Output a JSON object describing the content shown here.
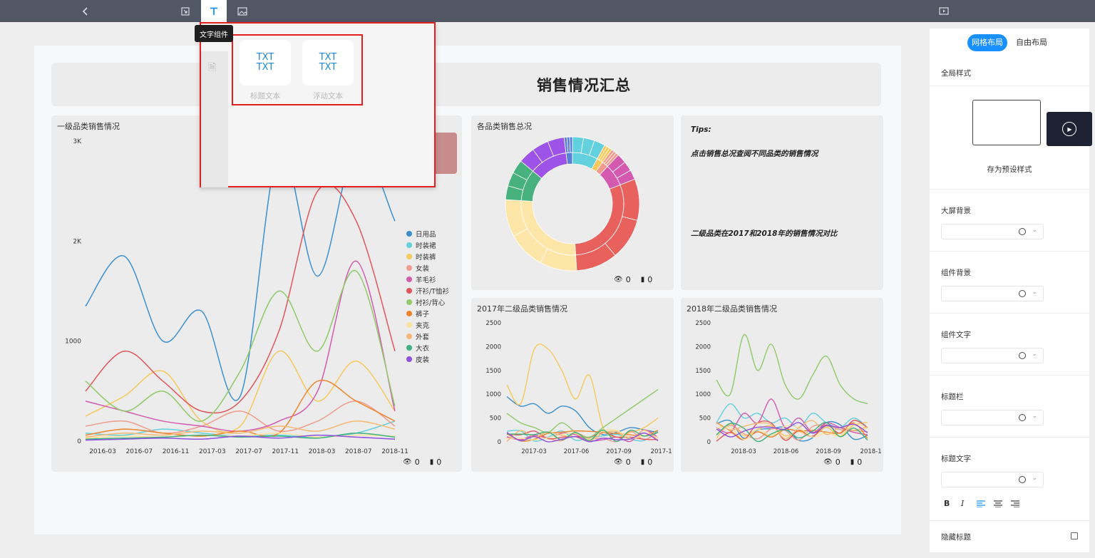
{
  "toolbar": {
    "back_icon": "chevron-left-icon",
    "tooltip": "文字组件",
    "icons": [
      "exit-icon",
      "text-icon",
      "image-icon",
      "preview-icon"
    ]
  },
  "dashboard": {
    "title": "各品类销售情况汇总",
    "title_visible": "销售情况汇总",
    "panel1_title": "一级品类销售情况",
    "panel2_title": "各品类销售总况",
    "panel3_title": "2017年二级品类销售情况",
    "panel4_title": "2018年二级品类销售情况",
    "tips_title": "Tips:",
    "tips_line1": "点击销售总况查阅不同品类的销售情况",
    "tips_line2": "二级品类在2017和2018年的销售情况对比",
    "views": "0",
    "comments": "0"
  },
  "popup": {
    "card1_line1": "TXT",
    "card1_line2": "TXT",
    "card1_label": "标题文本",
    "card2_line1": "TXT",
    "card2_line2": "TXT",
    "card2_label": "浮动文本"
  },
  "right_panel": {
    "tab_grid": "网格布局",
    "tab_free": "自由布局",
    "global_style": "全局样式",
    "save_preset": "存为预设样式",
    "screen_bg": "大屏背景",
    "component_bg": "组件背景",
    "component_text": "组件文字",
    "title_bar": "标题栏",
    "title_text": "标题文字",
    "bold": "B",
    "italic": "I",
    "hide_title": "隐藏标题"
  },
  "chart_data": [
    {
      "type": "line",
      "title": "一级品类销售情况",
      "x": [
        "2016-03",
        "2016-07",
        "2016-11",
        "2017-03",
        "2017-07",
        "2017-11",
        "2018-03",
        "2018-07",
        "2018-11"
      ],
      "ylim": [
        0,
        3000
      ],
      "yticks": [
        "3K",
        "2K",
        "1000",
        "0"
      ],
      "legend": "right",
      "series": [
        {
          "name": "日用品",
          "color": "#3b8fd1",
          "values": [
            1350,
            1850,
            1000,
            1300,
            450,
            2900,
            1650,
            2950,
            2200
          ]
        },
        {
          "name": "时装裙",
          "color": "#62d0dd",
          "values": [
            80,
            60,
            120,
            80,
            50,
            60,
            40,
            80,
            200
          ]
        },
        {
          "name": "时装裤",
          "color": "#f7c85a",
          "values": [
            250,
            450,
            700,
            200,
            150,
            900,
            400,
            800,
            300
          ]
        },
        {
          "name": "女装",
          "color": "#f09b8c",
          "values": [
            150,
            200,
            80,
            150,
            300,
            100,
            200,
            400,
            150
          ]
        },
        {
          "name": "羊毛衫",
          "color": "#d45ab0",
          "values": [
            400,
            300,
            200,
            150,
            100,
            200,
            500,
            1800,
            300
          ]
        },
        {
          "name": "汗衫/T恤衫",
          "color": "#e0565b",
          "values": [
            500,
            900,
            600,
            300,
            400,
            1100,
            2500,
            2200,
            900
          ]
        },
        {
          "name": "衬衫/背心",
          "color": "#8fc968",
          "values": [
            600,
            300,
            500,
            200,
            700,
            1500,
            900,
            1700,
            350
          ]
        },
        {
          "name": "裤子",
          "color": "#f0842a",
          "values": [
            60,
            120,
            80,
            50,
            100,
            80,
            600,
            400,
            200
          ]
        },
        {
          "name": "夹克",
          "color": "#fce29a",
          "values": [
            30,
            50,
            40,
            60,
            50,
            80,
            40,
            60,
            50
          ]
        },
        {
          "name": "外套",
          "color": "#f5b971",
          "values": [
            40,
            80,
            60,
            100,
            80,
            150,
            100,
            200,
            120
          ]
        },
        {
          "name": "大衣",
          "color": "#3db17e",
          "values": [
            20,
            30,
            40,
            60,
            40,
            50,
            30,
            80,
            40
          ]
        },
        {
          "name": "皮装",
          "color": "#8e4fe0",
          "values": [
            10,
            20,
            30,
            20,
            50,
            30,
            60,
            40,
            20
          ]
        }
      ]
    },
    {
      "type": "pie",
      "title": "各品类销售总况",
      "series": [
        {
          "name": "汗衫/T恤衫",
          "color": "#e8615d",
          "value": 30
        },
        {
          "name": "夹克",
          "color": "#fde6a8",
          "value": 27
        },
        {
          "name": "大衣",
          "color": "#47b27d",
          "value": 10
        },
        {
          "name": "皮装",
          "color": "#9d52e8",
          "value": 12
        },
        {
          "name": "日用品",
          "color": "#5a7fd8",
          "value": 2
        },
        {
          "name": "时装裙",
          "color": "#62d0dd",
          "value": 8
        },
        {
          "name": "时装裤",
          "color": "#f7c85a",
          "value": 2
        },
        {
          "name": "女装",
          "color": "#f09b8c",
          "value": 2
        },
        {
          "name": "羊毛衫",
          "color": "#d45ab0",
          "value": 7
        }
      ]
    },
    {
      "type": "line",
      "title": "2017年二级品类销售情况",
      "x": [
        "2017-03",
        "2017-06",
        "2017-09",
        "2017-1"
      ],
      "ylim": [
        0,
        2500
      ],
      "yticks": [
        "2500",
        "2000",
        "1500",
        "1000",
        "500",
        "0"
      ]
    },
    {
      "type": "line",
      "title": "2018年二级品类销售情况",
      "x": [
        "2018-03",
        "2018-06",
        "2018-09",
        "2018-1"
      ],
      "ylim": [
        0,
        2500
      ],
      "yticks": [
        "2500",
        "2000",
        "1500",
        "1000",
        "500",
        "0"
      ]
    }
  ]
}
